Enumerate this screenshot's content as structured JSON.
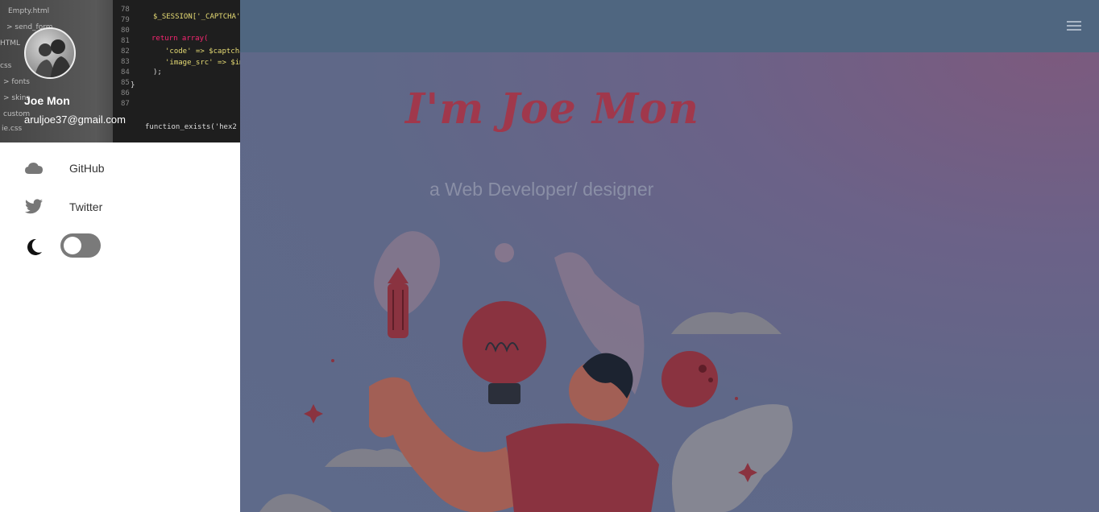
{
  "sidebar": {
    "profile": {
      "name": "Joe Mon",
      "email": "aruljoe37@gmail.com"
    },
    "nav": [
      {
        "label": "GitHub",
        "icon": "cloud-icon"
      },
      {
        "label": "Twitter",
        "icon": "twitter-icon"
      }
    ],
    "theme": {
      "icon": "moon-icon",
      "dark_mode_enabled": false
    }
  },
  "header": {
    "menu_icon": "hamburger-icon"
  },
  "hero": {
    "title": "I'm Joe Mon",
    "subtitle": "a Web Developer/ designer"
  },
  "colors": {
    "topbar": "#4f6680",
    "accent": "#a0384c",
    "toggle_track": "#7a7a7a"
  }
}
